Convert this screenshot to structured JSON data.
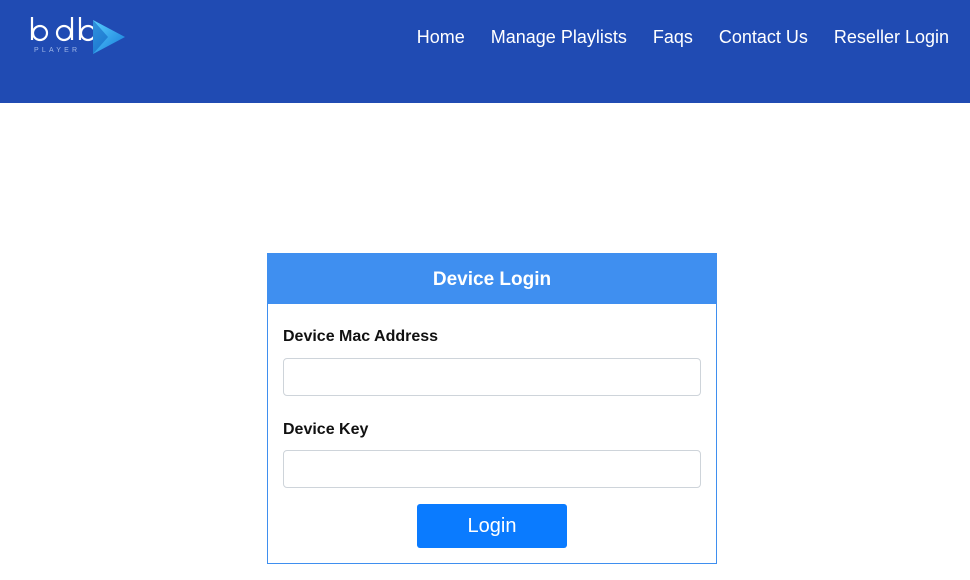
{
  "brand": {
    "logo_text": "bdb",
    "logo_subtext": "PLAYER",
    "icon": "play-triangle-icon",
    "color": "#29a3e8"
  },
  "nav": {
    "items": [
      {
        "label": "Home"
      },
      {
        "label": "Manage Playlists"
      },
      {
        "label": "Faqs"
      },
      {
        "label": "Contact Us"
      },
      {
        "label": "Reseller Login"
      }
    ]
  },
  "login": {
    "title": "Device Login",
    "mac_label": "Device Mac Address",
    "mac_value": "",
    "key_label": "Device Key",
    "key_value": "",
    "submit_label": "Login"
  },
  "colors": {
    "navbar": "#204bb3",
    "card_header": "#3f8ff0",
    "button": "#0a7bff"
  }
}
